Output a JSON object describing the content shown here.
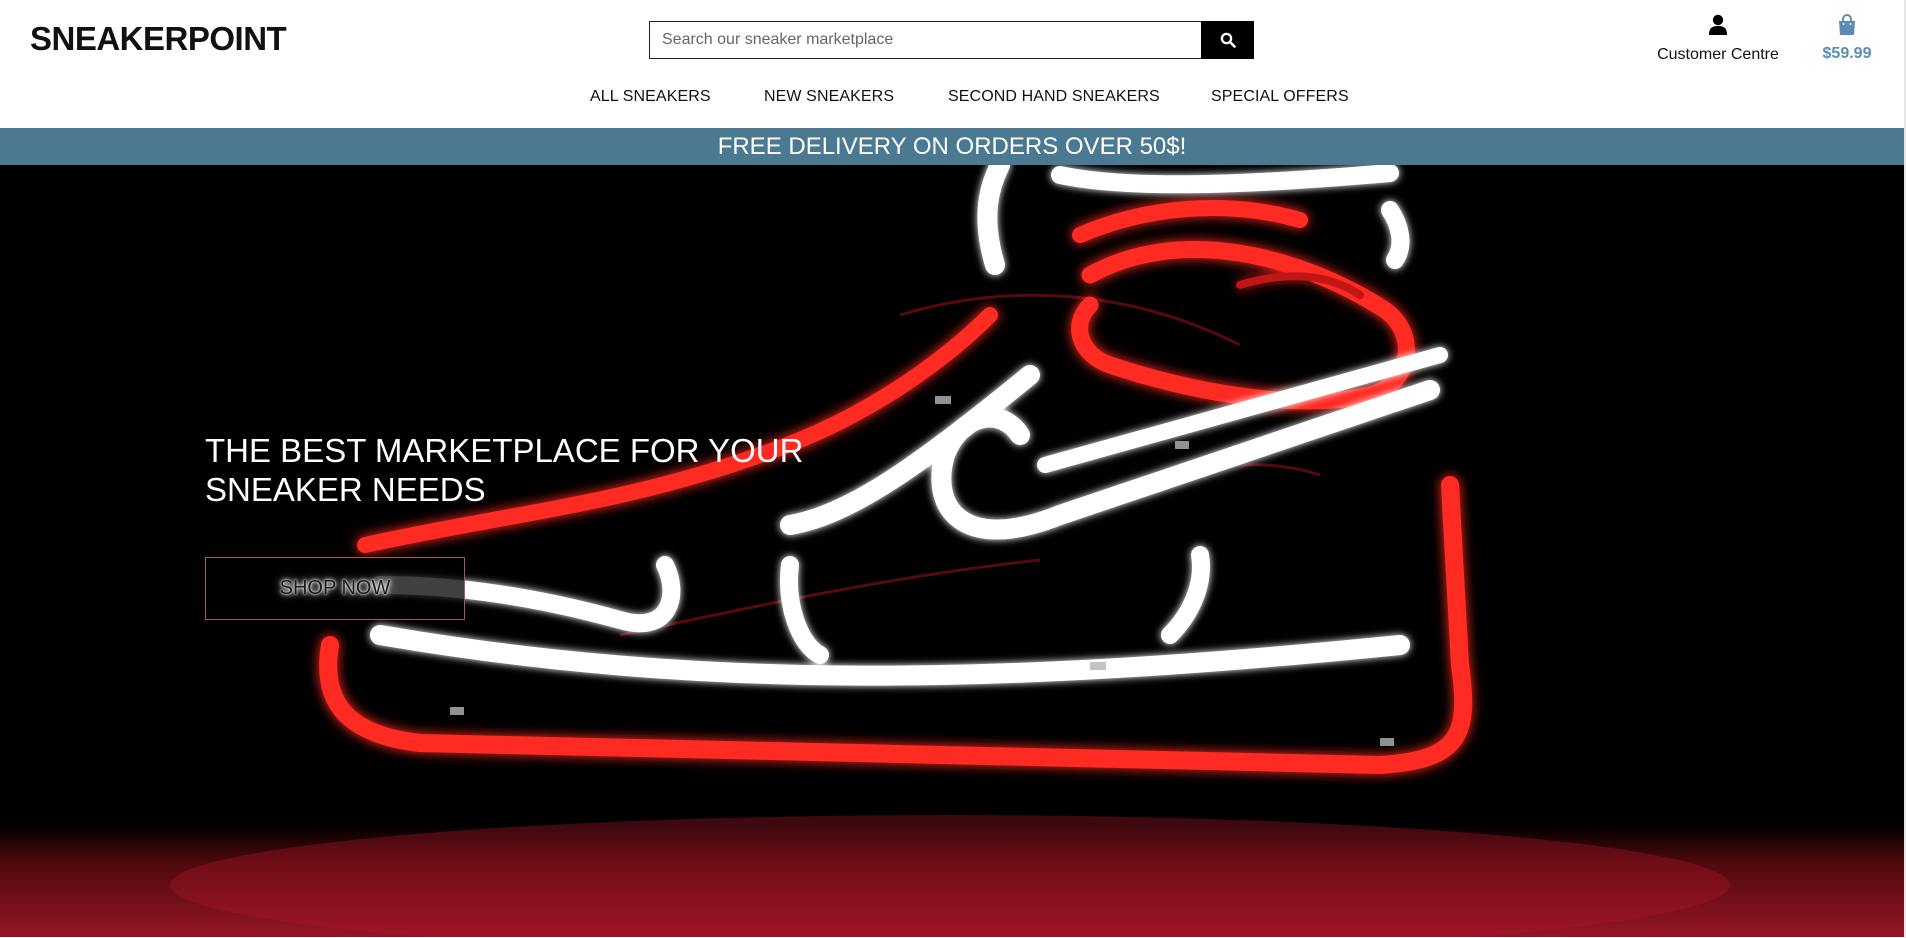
{
  "header": {
    "logo": "SNEAKERPOINT",
    "search": {
      "placeholder": "Search our sneaker marketplace",
      "value": ""
    },
    "account_label": "Customer Centre",
    "cart_total": "$59.99"
  },
  "nav": {
    "items": [
      "ALL SNEAKERS",
      "NEW SNEAKERS",
      "SECOND HAND SNEAKERS",
      "SPECIAL OFFERS"
    ]
  },
  "banner": {
    "text": "FREE DELIVERY ON ORDERS OVER 50$!"
  },
  "hero": {
    "headline": "THE BEST MARKETPLACE FOR YOUR SNEAKER NEEDS",
    "cta_label": "SHOP NOW"
  },
  "colors": {
    "banner_bg": "#4a7991",
    "cart_accent": "#5a8cb6",
    "neon_red": "#e0231c",
    "neon_white": "#ffffff"
  },
  "icons": {
    "search": "search-icon",
    "account": "user-icon",
    "cart": "shopping-bag-icon"
  }
}
